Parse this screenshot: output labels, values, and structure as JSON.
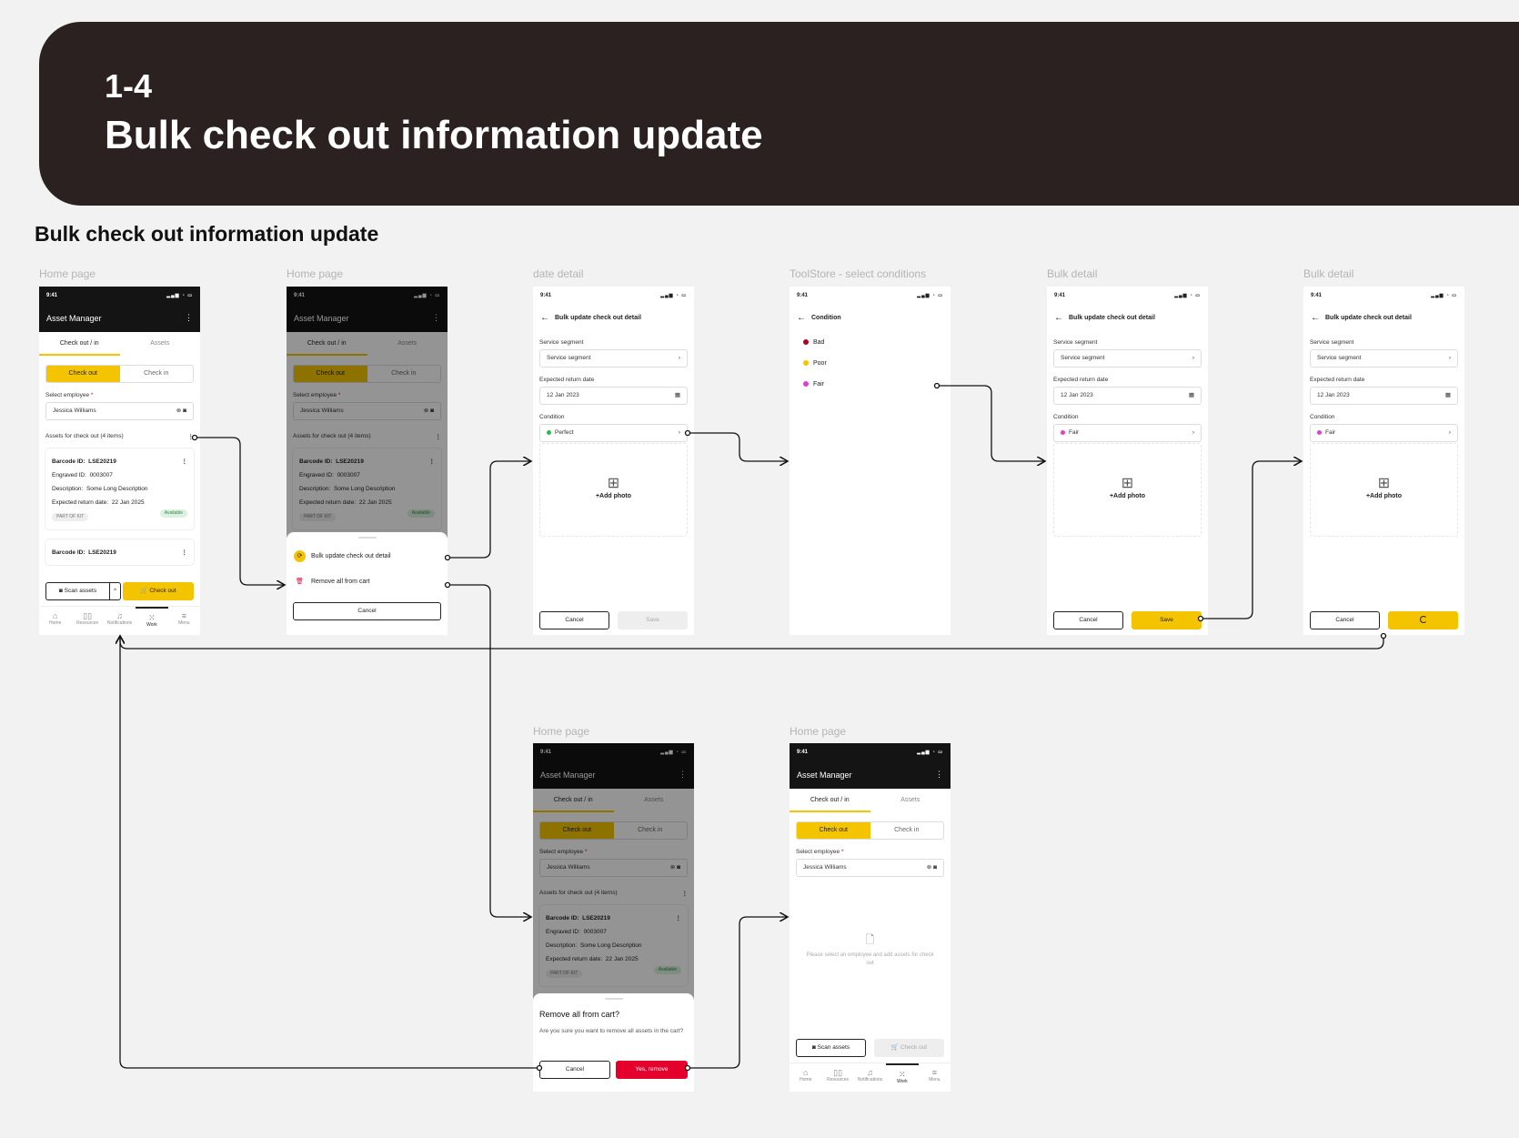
{
  "header": {
    "number": "1-4",
    "title": "Bulk check out information update"
  },
  "section_title": "Bulk check out information update",
  "frame_labels": {
    "f1": "Home page",
    "f2": "Home page",
    "f3": "date detail",
    "f4": "ToolStore - select conditions",
    "f5": "Bulk detail",
    "f6": "Bulk detail",
    "f7": "Home page",
    "f8": "Home page"
  },
  "status": {
    "time": "9:41",
    "icons": "▂▄▆ ◔ ▭"
  },
  "app": {
    "title": "Asset Manager",
    "menu_icon": "⋮",
    "tab_checkout": "Check out / in",
    "tab_assets": "Assets",
    "seg_checkout": "Check out",
    "seg_checkin": "Check in",
    "select_employee": "Select employee",
    "required": "*",
    "employee": "Jessica Williams",
    "clear_icon": "⊗",
    "camera_icon": "◙",
    "assets_header": "Assets for check out  (4 items)",
    "kebab": "⋮"
  },
  "asset": {
    "barcode_label": "Barcode ID:",
    "barcode": "LSE20219",
    "engraved_label": "Engraved ID:",
    "engraved": "0003007",
    "desc_label": "Description:",
    "desc": "Some Long Description",
    "return_label": "Expected return date:",
    "return": "22 Jan 2025",
    "kit": "PART OF KIT",
    "status": "Available"
  },
  "actions": {
    "scan": "Scan assets",
    "checkout": "Check out",
    "chevron_up": "^",
    "cart_icon": "🛒"
  },
  "nav": [
    {
      "label": "Home",
      "glyph": "⌂"
    },
    {
      "label": "Resources",
      "glyph": "▯▯"
    },
    {
      "label": "Notifications",
      "glyph": "♫"
    },
    {
      "label": "Work",
      "glyph": "⁙"
    },
    {
      "label": "Menu",
      "glyph": "≡"
    }
  ],
  "sheet": {
    "bulk": "Bulk update check out detail",
    "remove": "Remove all from cart",
    "cancel": "Cancel",
    "bulk_icon": "⟳",
    "remove_icon": "🗑"
  },
  "detail": {
    "title": "Bulk update check out detail",
    "back": "←",
    "service_label": "Service segment",
    "service_value": "Service segment",
    "return_label": "Expected return date",
    "return_value": "12 Jan 2023",
    "calendar_icon": "▦",
    "condition_label": "Condition",
    "cond_perfect": "Perfect",
    "cond_fair": "Fair",
    "chevron": "›",
    "add_photo": "+Add photo",
    "photo_icon": "⊞",
    "cancel": "Cancel",
    "save": "Save"
  },
  "conditions": {
    "title": "Condition",
    "items": [
      {
        "label": "Bad",
        "color": "#b00020"
      },
      {
        "label": "Poor",
        "color": "#f5c400"
      },
      {
        "label": "Fair",
        "color": "#e040d0"
      }
    ]
  },
  "colors": {
    "perfect": "#2eb84b",
    "fair": "#e040d0",
    "accent": "#f5c400",
    "danger": "#e4002b"
  },
  "dialog": {
    "title": "Remove all from cart?",
    "body": "Are you sure you want to remove all assets in the cart?",
    "cancel": "Cancel",
    "confirm": "Yes, remove"
  },
  "empty": {
    "text": "Please select an employee and add assets for check out",
    "icon": "🗋"
  }
}
